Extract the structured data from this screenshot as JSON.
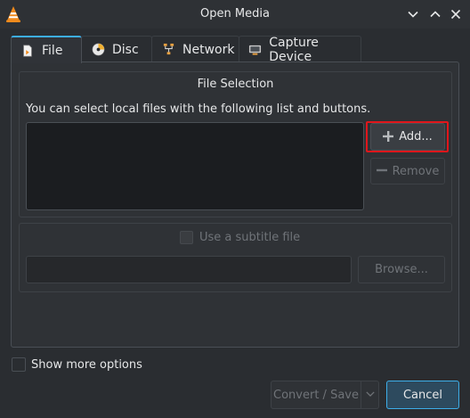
{
  "window": {
    "title": "Open Media",
    "app_icon": "vlc-cone-icon",
    "controls": [
      "chevron-down-icon",
      "chevron-up-icon",
      "close-icon"
    ]
  },
  "tabs": [
    {
      "label": "File",
      "icon": "file-icon",
      "active": true
    },
    {
      "label": "Disc",
      "icon": "disc-icon",
      "active": false
    },
    {
      "label": "Network",
      "icon": "network-icon",
      "active": false
    },
    {
      "label": "Capture Device",
      "icon": "capture-device-icon",
      "active": false
    }
  ],
  "file_selection": {
    "title": "File Selection",
    "hint": "You can select local files with the following list and buttons.",
    "add_label": "Add...",
    "remove_label": "Remove"
  },
  "subtitle": {
    "checkbox_label": "Use a subtitle file",
    "browse_label": "Browse..."
  },
  "footer": {
    "show_more_label": "Show more options",
    "convert_label": "Convert / Save",
    "cancel_label": "Cancel"
  },
  "colors": {
    "accent": "#3daee9",
    "highlight": "#e0161b",
    "background": "#2a2d31"
  }
}
